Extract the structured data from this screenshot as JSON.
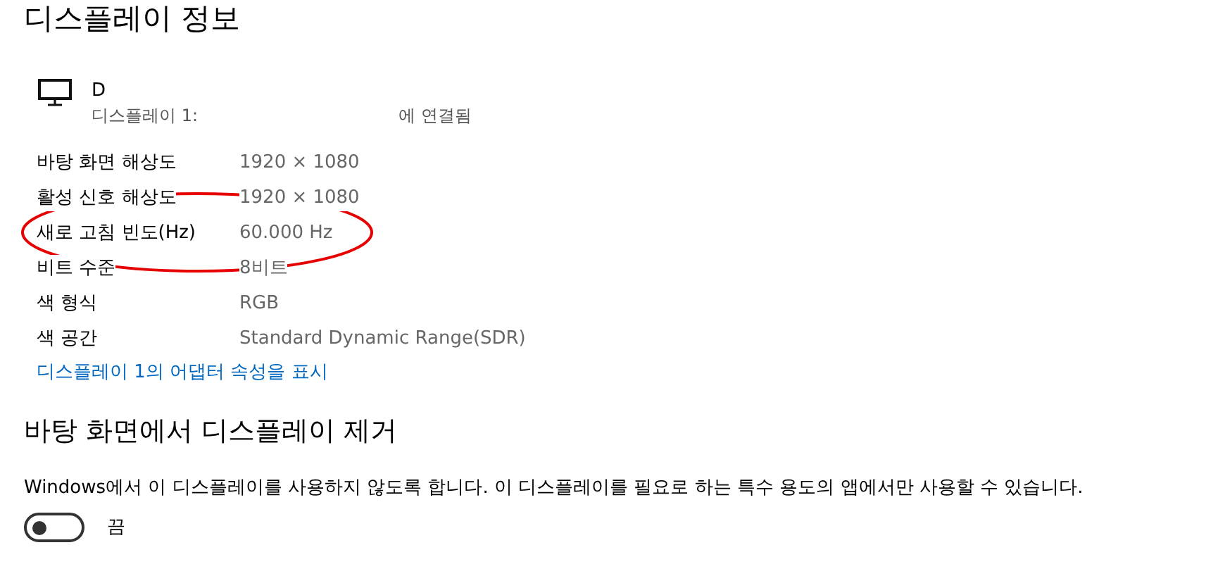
{
  "title": "디스플레이 정보",
  "display": {
    "name": "D",
    "subtitle": "디스플레이 1:",
    "connection": "에 연결됨"
  },
  "properties": [
    {
      "label": "바탕 화면 해상도",
      "value": "1920 × 1080",
      "highlighted": false
    },
    {
      "label": "활성 신호 해상도",
      "value": "1920 × 1080",
      "highlighted": false
    },
    {
      "label": "새로 고침 빈도(Hz)",
      "value": "60.000 Hz",
      "highlighted": true
    },
    {
      "label": "비트 수준",
      "value": "8비트",
      "highlighted": false
    },
    {
      "label": "색 형식",
      "value": "RGB",
      "highlighted": false
    },
    {
      "label": "색 공간",
      "value": "Standard Dynamic Range(SDR)",
      "highlighted": false
    }
  ],
  "adapter_link": "디스플레이 1의 어댑터 속성을 표시",
  "remove_section": {
    "heading": "바탕 화면에서 디스플레이 제거",
    "description": "Windows에서 이 디스플레이를 사용하지 않도록 합니다. 이 디스플레이를 필요로 하는 특수 용도의 앱에서만 사용할 수 있습니다.",
    "toggle_on": false,
    "toggle_label": "끔"
  }
}
